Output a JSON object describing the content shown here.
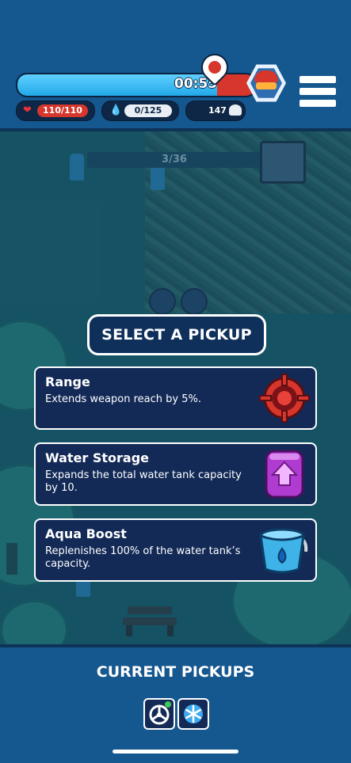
{
  "hud": {
    "timer": {
      "text": "00:55",
      "progress": 0.84
    },
    "health": {
      "text": "110/110",
      "current": 110,
      "max": 110,
      "icon": "heart-icon"
    },
    "water": {
      "text": "0/125",
      "current": 0,
      "max": 125,
      "icon": "water-drop-icon"
    },
    "coins": {
      "text": "147",
      "icon": "coin-pile-icon"
    },
    "boss_marker_icon": "boss-marker-icon",
    "avatar_icon": "firefighter-avatar-icon",
    "menu_icon": "hamburger-menu-icon"
  },
  "world": {
    "progress_text": "3/36"
  },
  "select_pickup": {
    "title": "SELECT A PICKUP",
    "options": [
      {
        "title": "Range",
        "description": "Extends weapon reach by 5%.",
        "icon": "target-icon",
        "color": "#d6362b"
      },
      {
        "title": "Water Storage",
        "description": "Expands the total water tank capacity by 10.",
        "icon": "upgrade-arrow-icon",
        "color": "#b03bd0"
      },
      {
        "title": "Aqua Boost",
        "description": "Replenishes 100% of the water tank’s capacity.",
        "icon": "water-bucket-icon",
        "color": "#3fb3e8"
      }
    ]
  },
  "current_pickups": {
    "title": "CURRENT PICKUPS",
    "items": [
      {
        "icon": "steering-wheel-icon"
      },
      {
        "icon": "snowflake-icon"
      }
    ]
  },
  "colors": {
    "panel_blue": "#15578f",
    "card_navy": "#132a57",
    "timer_blue": "#22a9e8",
    "health_red": "#d6362b"
  }
}
